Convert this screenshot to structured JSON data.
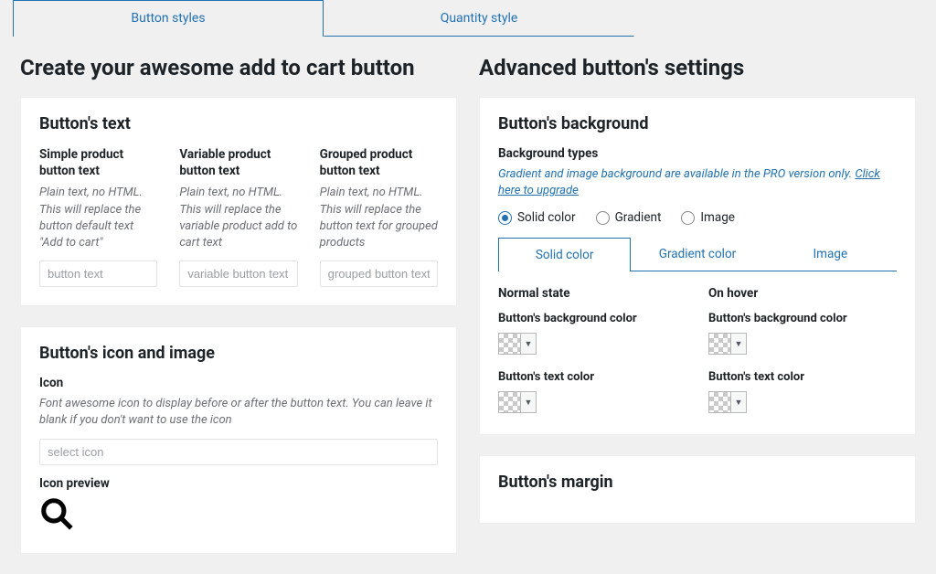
{
  "tabs": {
    "button_styles": "Button styles",
    "quantity_style": "Quantity style"
  },
  "left": {
    "title": "Create your awesome add to cart button",
    "card_text": {
      "heading": "Button's text",
      "simple": {
        "label": "Simple product button text",
        "desc": "Plain text, no HTML. This will replace the button default text \"Add to cart\"",
        "placeholder": "button text"
      },
      "variable": {
        "label": "Variable product button text",
        "desc": "Plain text, no HTML. This will replace the variable product add to cart text",
        "placeholder": "variable button text"
      },
      "grouped": {
        "label": "Grouped product button text",
        "desc": "Plain text, no HTML. This will replace the button text for grouped products",
        "placeholder": "grouped button text"
      }
    },
    "card_icon": {
      "heading": "Button's icon and image",
      "icon_label": "Icon",
      "icon_desc": "Font awesome icon to display before or after the button text. You can leave it blank if you don't want to use the icon",
      "icon_placeholder": "select icon",
      "preview_label": "Icon preview"
    }
  },
  "right": {
    "title": "Advanced button's settings",
    "card_bg": {
      "heading": "Button's background",
      "types_label": "Background types",
      "pro_note_pre": "Gradient and image background are available in the PRO version only. ",
      "pro_note_link": "Click here to upgrade",
      "radios": {
        "solid": "Solid color",
        "gradient": "Gradient",
        "image": "Image"
      },
      "subtabs": {
        "solid": "Solid color",
        "gradient": "Gradient color",
        "image": "Image"
      },
      "normal_state": "Normal state",
      "hover_state": "On hover",
      "bg_color_label": "Button's background color",
      "text_color_label": "Button's text color"
    },
    "card_margin": {
      "heading": "Button's margin"
    }
  }
}
